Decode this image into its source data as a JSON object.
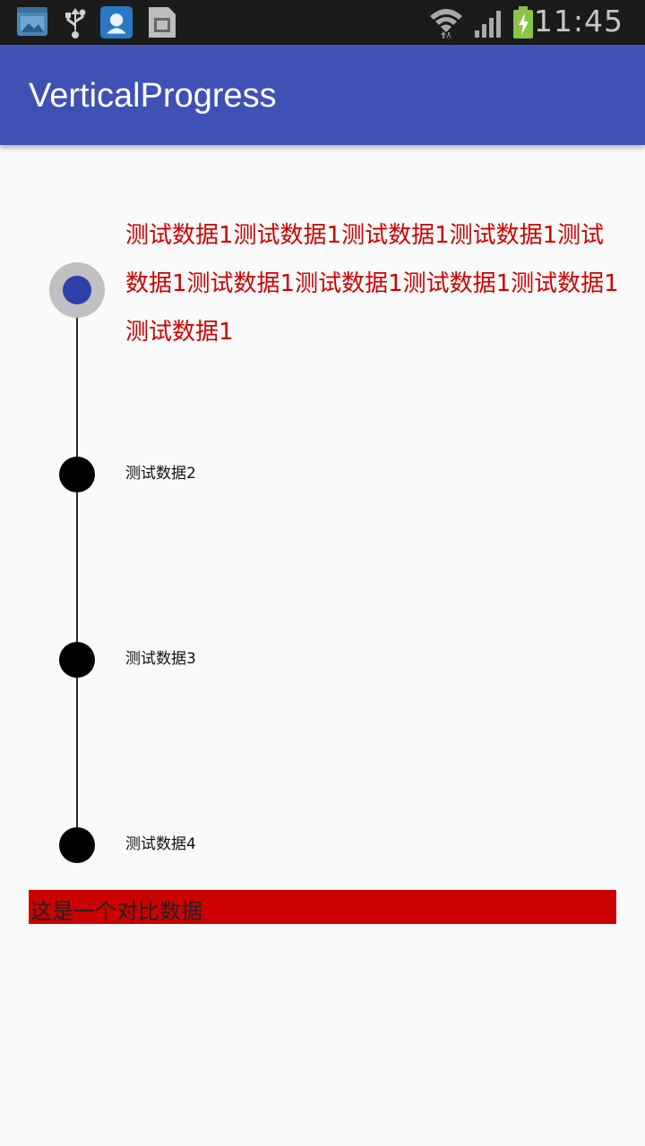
{
  "status_bar": {
    "time": "11:45",
    "icons": [
      "gallery-icon",
      "usb-icon",
      "app-icon",
      "sim-card-icon",
      "wifi-icon",
      "signal-icon",
      "battery-charging-icon"
    ]
  },
  "app_bar": {
    "title": "VerticalProgress",
    "color": "#3f51b5"
  },
  "timeline": {
    "current_step": 1,
    "steps": [
      {
        "label": "测试数据1测试数据1测试数据1测试数据1测试数据1测试数据1测试数据1测试数据1测试数据1测试数据1",
        "state": "active"
      },
      {
        "label": "测试数据2",
        "state": "inactive"
      },
      {
        "label": "测试数据3",
        "state": "inactive"
      },
      {
        "label": "测试数据4",
        "state": "inactive"
      }
    ],
    "active_color": "#2f3fa8",
    "active_text_color": "#d00000"
  },
  "comparison": {
    "text": "这是一个对比数据",
    "background": "#cc0000"
  }
}
